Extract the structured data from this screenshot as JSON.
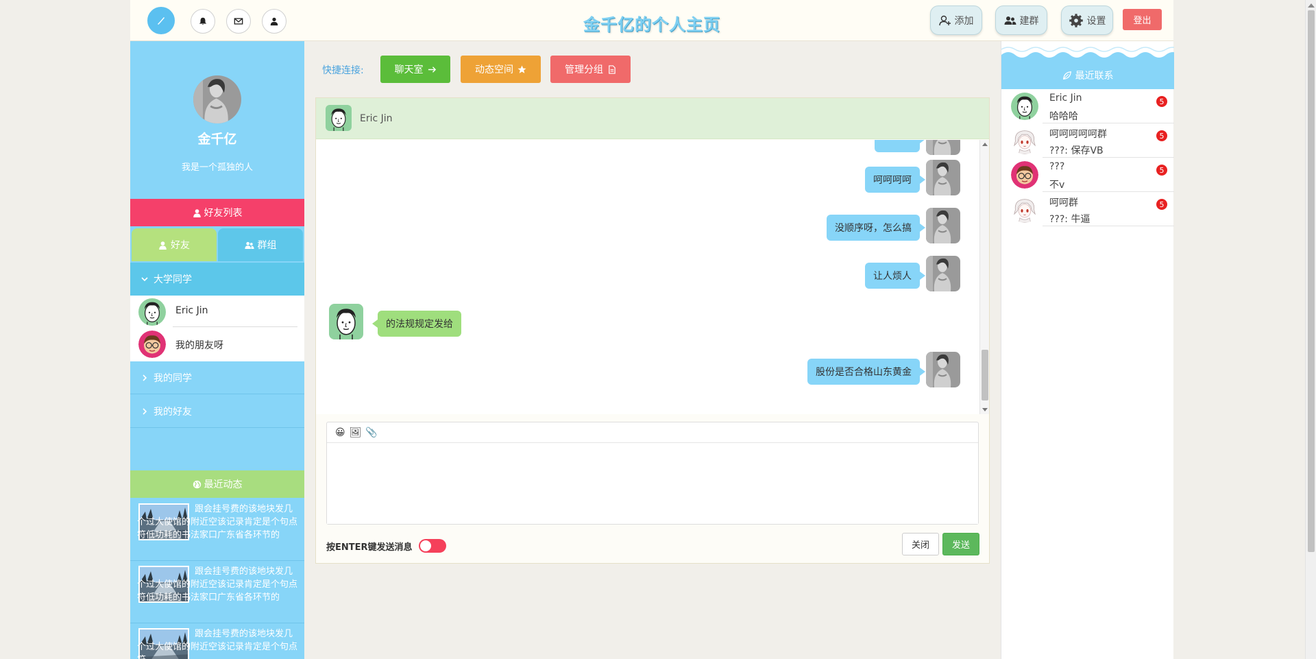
{
  "topbar": {
    "title": "金千亿的个人主页",
    "add_label": "添加",
    "create_group_label": "建群",
    "settings_label": "设置",
    "logout_label": "登出"
  },
  "profile": {
    "name": "金千亿",
    "signature": "我是一个孤独的人"
  },
  "left": {
    "friends_list_title": "好友列表",
    "tab_friends": "好友",
    "tab_groups": "群组",
    "groups": [
      {
        "name": "大学同学",
        "expanded": true,
        "members": [
          "Eric Jin",
          "我的朋友呀"
        ]
      },
      {
        "name": "我的同学",
        "expanded": false
      },
      {
        "name": "我的好友",
        "expanded": false
      }
    ],
    "recent_dynamics_title": "最近动态",
    "dynamics": [
      {
        "text": "跟会挂号费的该地块发几个过大使馆的附近空该记录肯定是个句点符低功耗的书法家口广东省各环节的"
      },
      {
        "text": "跟会挂号费的该地块发几个过大使馆的附近空该记录肯定是个句点符低功耗的书法家口广东省各环节的"
      },
      {
        "text": "跟会挂号费的该地块发几个过大使馆的附近空该记录肯定是个句点符"
      }
    ]
  },
  "quick_links": {
    "label": "快捷连接:",
    "chat_room": "聊天室",
    "moments": "动态空间",
    "manage_groups": "管理分组",
    "colors": {
      "chat_room": "#5bbd3a",
      "moments": "#eea236",
      "manage_groups": "#f06a6a"
    }
  },
  "chat": {
    "contact_name": "Eric Jin",
    "messages": [
      {
        "from": "me",
        "text": "呵呵呵呵"
      },
      {
        "from": "me",
        "text": "没顺序呀，怎么搞"
      },
      {
        "from": "me",
        "text": "让人烦人"
      },
      {
        "from": "them",
        "text": "的法规规定发给"
      },
      {
        "from": "me",
        "text": "股份是否合格山东黄金"
      }
    ],
    "editor_icons": [
      "smile-icon",
      "image-icon",
      "paperclip-icon"
    ],
    "enter_to_send_label": "按ENTER键发送消息",
    "enter_to_send_enabled": false,
    "close_label": "关闭",
    "send_label": "发送"
  },
  "recent_contacts": {
    "title": "最近联系",
    "items": [
      {
        "name": "Eric Jin",
        "last": "哈哈哈",
        "badge": "5"
      },
      {
        "name": "呵呵呵呵呵群",
        "last": "???: 保存VB",
        "badge": "5"
      },
      {
        "name": "???",
        "last": "不v",
        "badge": "5"
      },
      {
        "name": "呵呵群",
        "last": "???: 牛逼",
        "badge": "5"
      }
    ]
  }
}
